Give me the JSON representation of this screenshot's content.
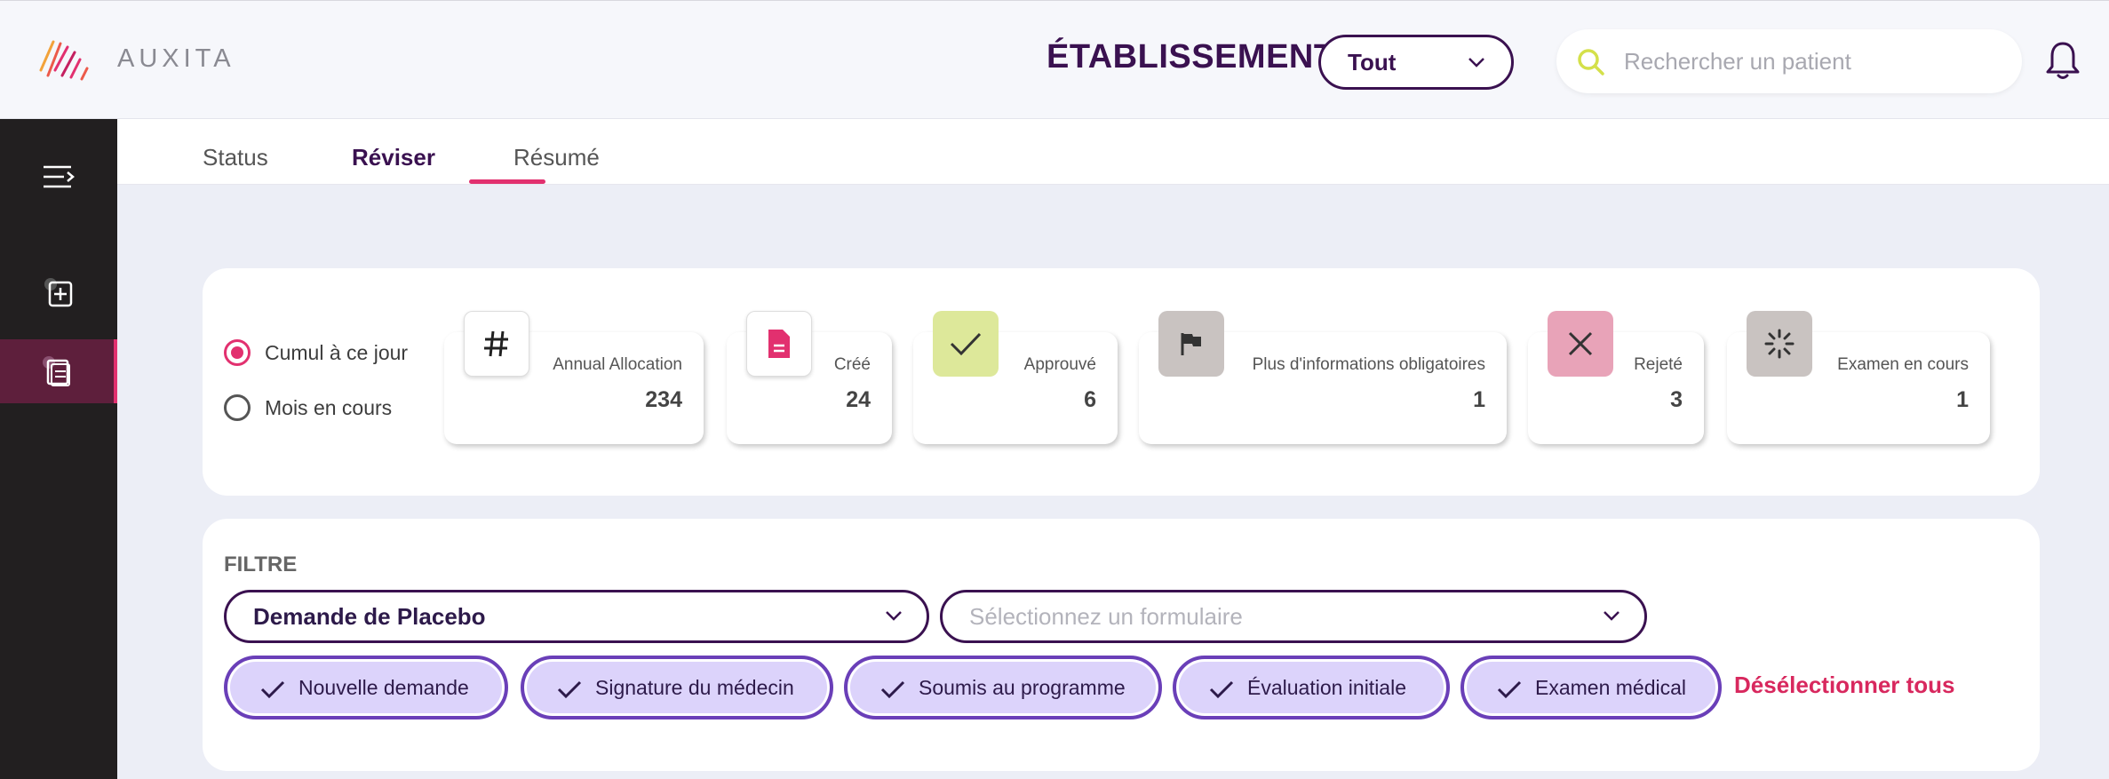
{
  "header": {
    "logo_text": "AUXITA",
    "establishment_label": "ÉTABLISSEMENT",
    "establishment_select": "Tout",
    "search_placeholder": "Rechercher un patient"
  },
  "tabs": [
    {
      "label": "Status"
    },
    {
      "label": "Réviser"
    },
    {
      "label": "Résumé"
    }
  ],
  "period": {
    "options": [
      {
        "label": "Cumul à ce jour",
        "selected": true
      },
      {
        "label": "Mois en cours",
        "selected": false
      }
    ]
  },
  "stats": [
    {
      "label": "Annual Allocation",
      "value": "234",
      "icon": "hash-icon"
    },
    {
      "label": "Créé",
      "value": "24",
      "icon": "document-icon"
    },
    {
      "label": "Approuvé",
      "value": "6",
      "icon": "check-icon"
    },
    {
      "label": "Plus d'informations obligatoires",
      "value": "1",
      "icon": "flag-icon"
    },
    {
      "label": "Rejeté",
      "value": "3",
      "icon": "close-icon"
    },
    {
      "label": "Examen en cours",
      "value": "1",
      "icon": "spinner-icon"
    }
  ],
  "filter": {
    "title": "FILTRE",
    "request_type": "Demande de Placebo",
    "form_placeholder": "Sélectionnez un formulaire",
    "chips": [
      {
        "label": "Nouvelle demande"
      },
      {
        "label": "Signature du médecin"
      },
      {
        "label": "Soumis au programme"
      },
      {
        "label": "Évaluation initiale"
      },
      {
        "label": "Examen médical"
      }
    ],
    "deselect_all": "Désélectionner tous"
  },
  "colors": {
    "brand_purple": "#3a1150",
    "accent_pink": "#e2306f",
    "chip_bg": "#dcd3fb",
    "chip_border": "#6a3fb8",
    "sidebar_bg": "#221f20"
  }
}
